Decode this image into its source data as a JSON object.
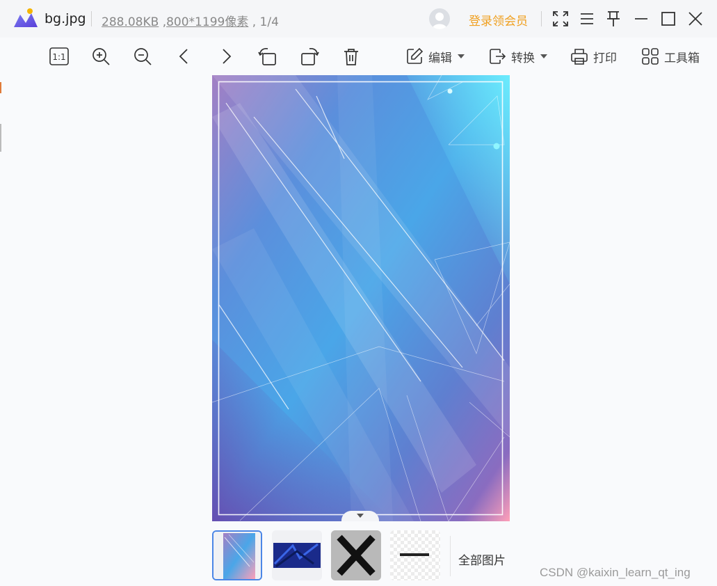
{
  "titlebar": {
    "file_name": "bg.jpg",
    "file_size": "288.08KB",
    "dims_sep": " ,",
    "dimensions": "800*1199像素",
    "page_index": " , 1/4",
    "login_label": "登录领会员",
    "icons": [
      "app-logo",
      "avatar-icon",
      "fullscreen-icon",
      "menu-icon",
      "pin-icon",
      "minimize-icon",
      "maximize-icon",
      "close-icon"
    ]
  },
  "toolbar": {
    "actual_size_label": "1:1",
    "edit_label": "编辑",
    "convert_label": "转换",
    "print_label": "打印",
    "tools_label": "工具箱",
    "icons": [
      "actual-size-icon",
      "zoom-in-icon",
      "zoom-out-icon",
      "previous-icon",
      "next-icon",
      "rotate-left-icon",
      "rotate-right-icon",
      "delete-icon",
      "edit-icon",
      "convert-icon",
      "print-icon",
      "toolbox-icon"
    ]
  },
  "thumbnails": {
    "items": [
      "bg.jpg",
      "blue-texture",
      "close-x",
      "minus"
    ],
    "active_index": 0,
    "all_images_label": "全部图片"
  },
  "watermark": "CSDN @kaixin_learn_qt_ing",
  "colors": {
    "accent": "#f0a020",
    "selection": "#4b86e6",
    "background": "#f9fafc"
  }
}
